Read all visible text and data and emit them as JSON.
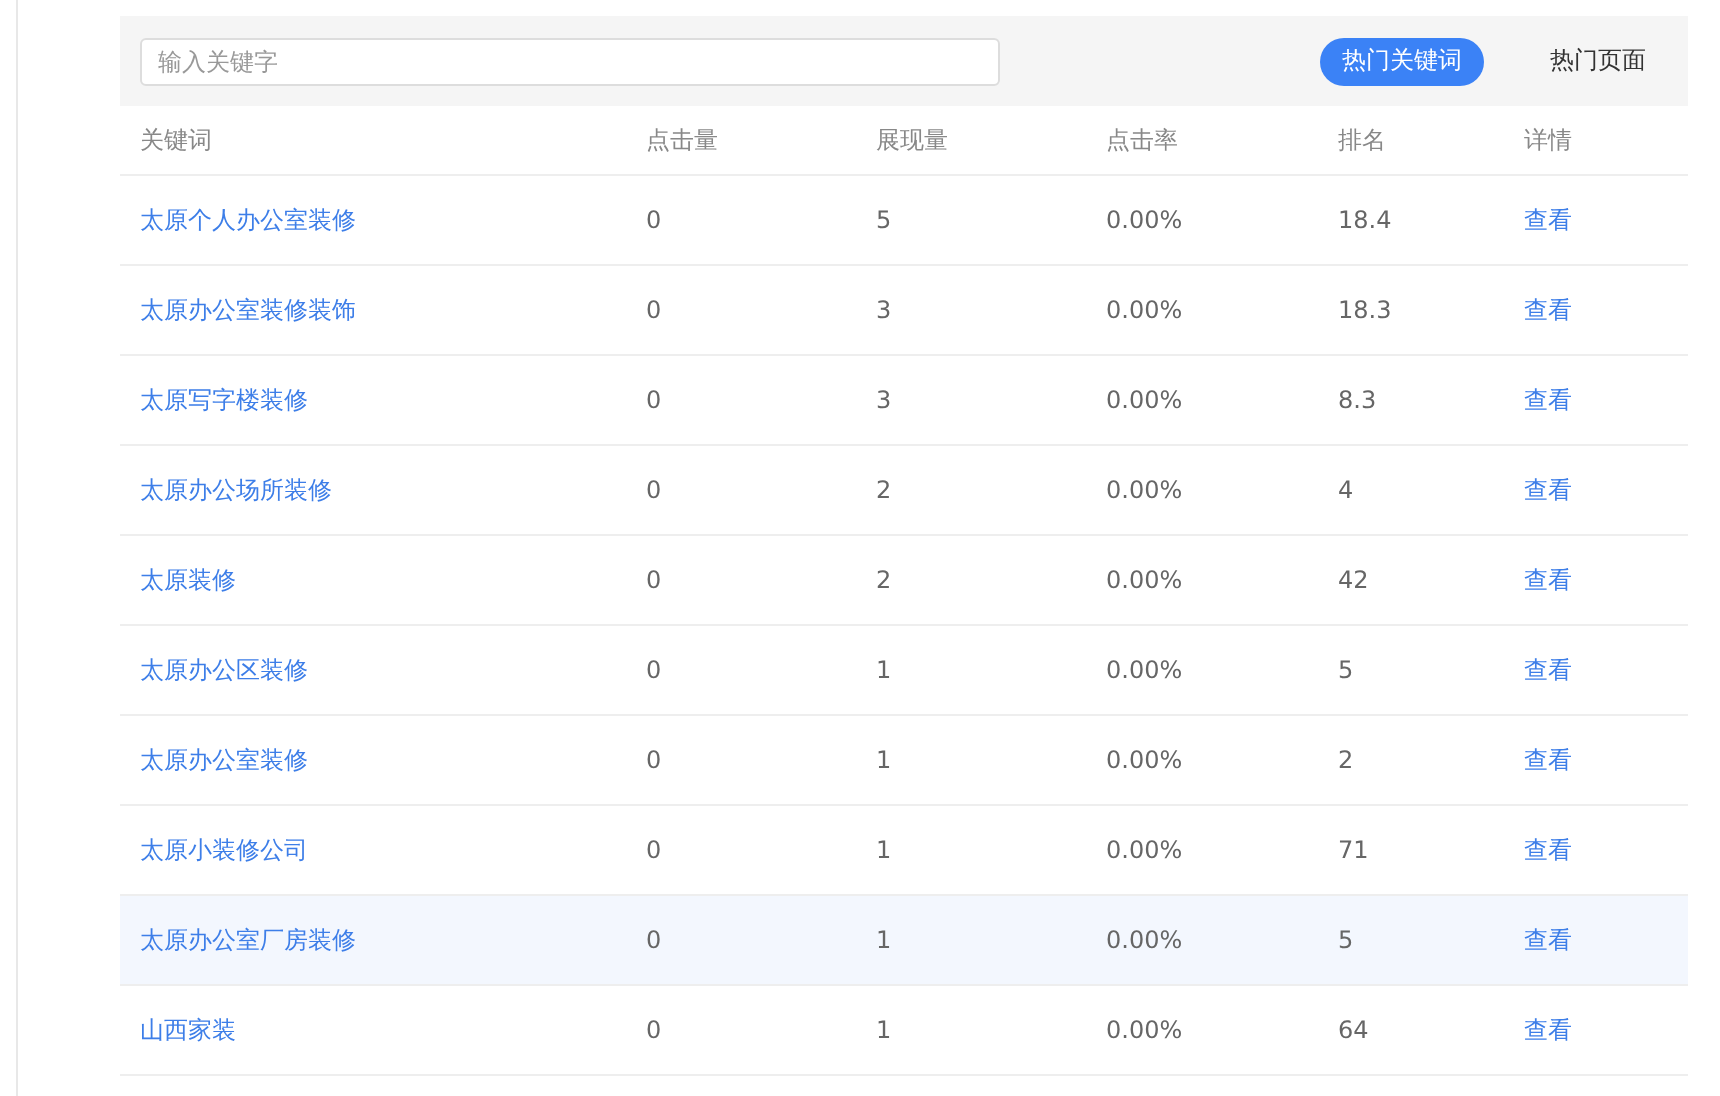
{
  "search": {
    "placeholder": "输入关键字"
  },
  "tabs": [
    {
      "label": "热门关键词",
      "selected": true
    },
    {
      "label": "热门页面",
      "selected": false
    }
  ],
  "table": {
    "columns": [
      "关键词",
      "点击量",
      "展现量",
      "点击率",
      "排名",
      "详情"
    ],
    "rows": [
      {
        "keyword": "太原个人办公室装修",
        "clicks": "0",
        "impressions": "5",
        "ctr": "0.00%",
        "rank": "18.4",
        "detail": "查看",
        "selected": false
      },
      {
        "keyword": "太原办公室装修装饰",
        "clicks": "0",
        "impressions": "3",
        "ctr": "0.00%",
        "rank": "18.3",
        "detail": "查看",
        "selected": false
      },
      {
        "keyword": "太原写字楼装修",
        "clicks": "0",
        "impressions": "3",
        "ctr": "0.00%",
        "rank": "8.3",
        "detail": "查看",
        "selected": false
      },
      {
        "keyword": "太原办公场所装修",
        "clicks": "0",
        "impressions": "2",
        "ctr": "0.00%",
        "rank": "4",
        "detail": "查看",
        "selected": false
      },
      {
        "keyword": "太原装修",
        "clicks": "0",
        "impressions": "2",
        "ctr": "0.00%",
        "rank": "42",
        "detail": "查看",
        "selected": false
      },
      {
        "keyword": "太原办公区装修",
        "clicks": "0",
        "impressions": "1",
        "ctr": "0.00%",
        "rank": "5",
        "detail": "查看",
        "selected": false
      },
      {
        "keyword": "太原办公室装修",
        "clicks": "0",
        "impressions": "1",
        "ctr": "0.00%",
        "rank": "2",
        "detail": "查看",
        "selected": false
      },
      {
        "keyword": "太原小装修公司",
        "clicks": "0",
        "impressions": "1",
        "ctr": "0.00%",
        "rank": "71",
        "detail": "查看",
        "selected": false
      },
      {
        "keyword": "太原办公室厂房装修",
        "clicks": "0",
        "impressions": "1",
        "ctr": "0.00%",
        "rank": "5",
        "detail": "查看",
        "selected": true
      },
      {
        "keyword": "山西家装",
        "clicks": "0",
        "impressions": "1",
        "ctr": "0.00%",
        "rank": "64",
        "detail": "查看",
        "selected": false
      }
    ]
  }
}
